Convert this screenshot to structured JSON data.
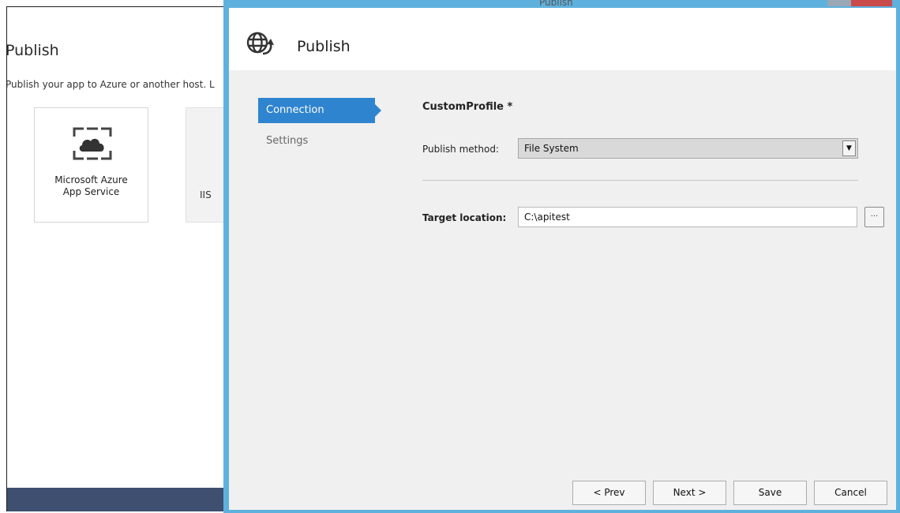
{
  "background_window": {
    "title": "Publish",
    "subtitle": "Publish your app to Azure or another host. L",
    "tiles": [
      {
        "label": "Microsoft Azure\nApp Service",
        "icon": "azure-cloud-icon"
      },
      {
        "label": "IIS",
        "icon": ""
      }
    ]
  },
  "dialog": {
    "window_title": "Publish",
    "title": "Publish",
    "title_icon": "globe-icon",
    "nav": {
      "connection": "Connection",
      "settings": "Settings"
    },
    "profile_name": "CustomProfile *",
    "publish_method": {
      "label": "Publish method:",
      "value": "File System"
    },
    "target_location": {
      "label": "Target location:",
      "value": "C:\\apitest",
      "browse_label": "..."
    },
    "buttons": {
      "prev": "< Prev",
      "next": "Next >",
      "save": "Save",
      "cancel": "Cancel"
    }
  },
  "colors": {
    "accent": "#2f84cf",
    "dialog_border": "#5fb1dd",
    "bg_footer": "#3e4f6f"
  }
}
